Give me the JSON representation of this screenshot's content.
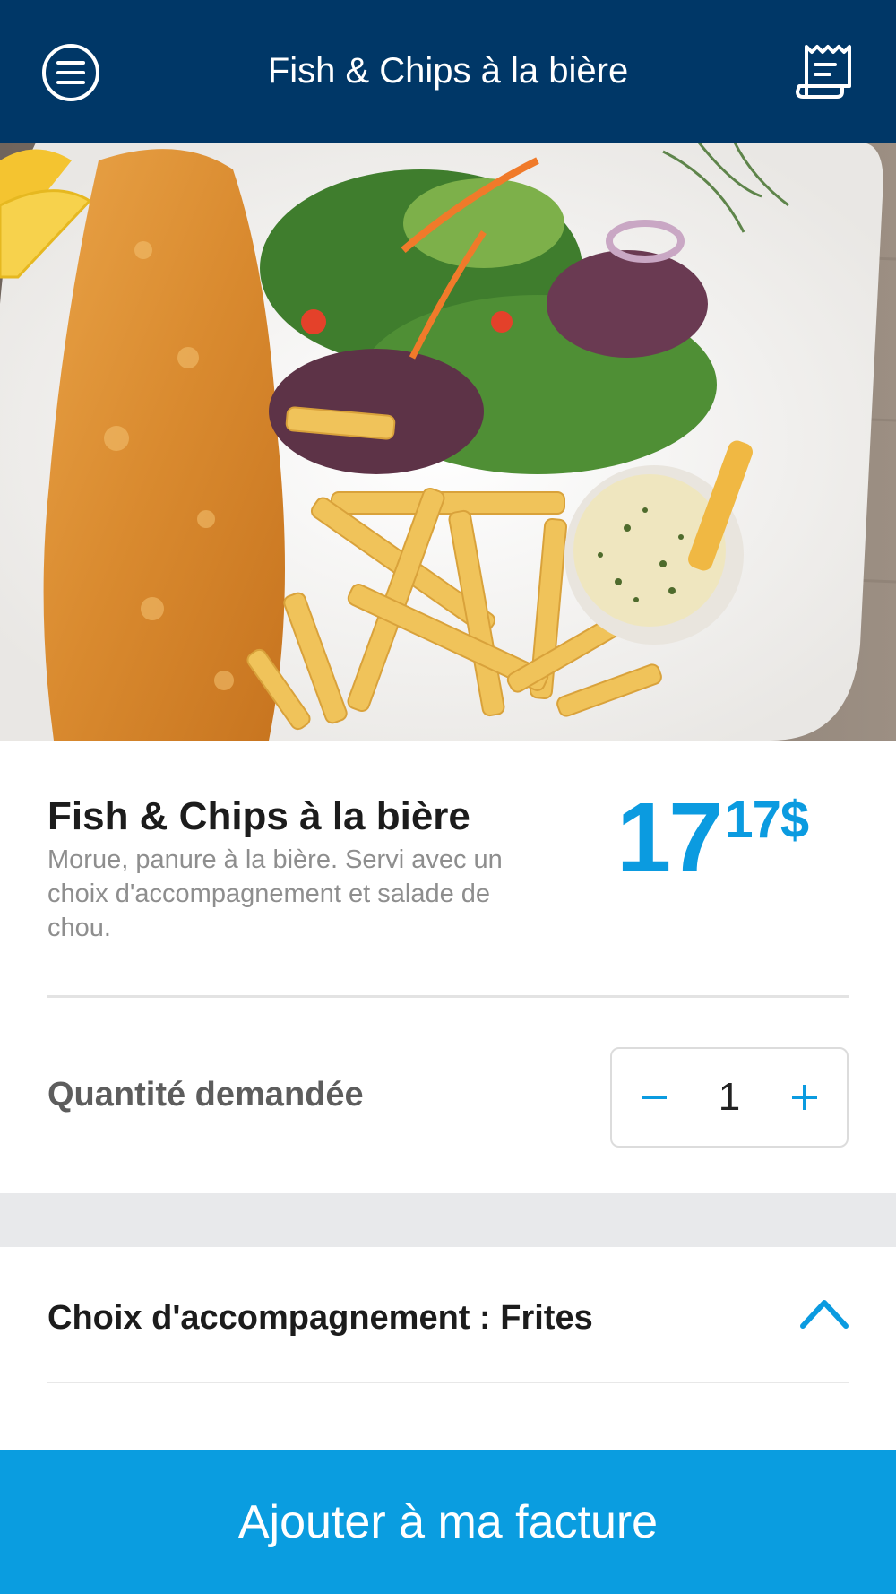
{
  "header": {
    "title": "Fish & Chips à la bière",
    "menu_icon": "hamburger-menu-icon",
    "receipt_icon": "receipt-icon"
  },
  "item": {
    "title": "Fish & Chips à la bière",
    "description": "Morue, panure à la bière. Servi avec un choix d'accompagnement et salade de chou.",
    "price_main": "17",
    "price_cents": "17$"
  },
  "quantity": {
    "label": "Quantité demandée",
    "value": "1",
    "decrement": "−",
    "increment": "+"
  },
  "side_choice": {
    "label": "Choix d'accompagnement : Frites",
    "expanded": true
  },
  "cta": {
    "label": "Ajouter à ma facture"
  },
  "colors": {
    "header_bg": "#003767",
    "accent": "#0a9de0",
    "separator_bg": "#e8e9eb"
  }
}
